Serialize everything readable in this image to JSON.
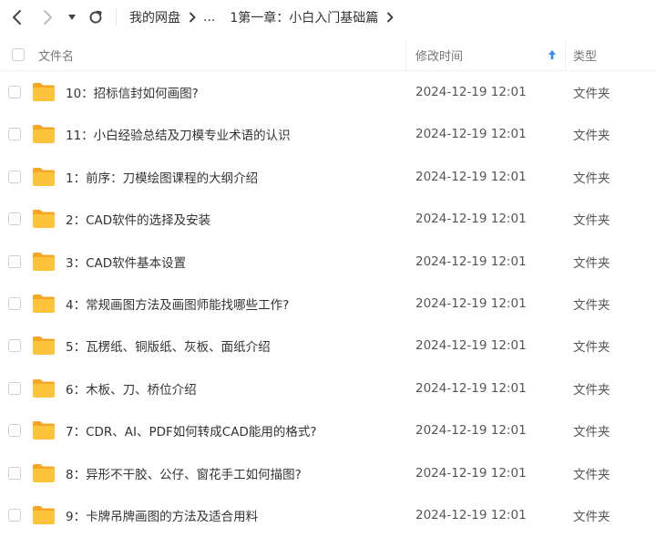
{
  "breadcrumb": {
    "root": "我的网盘",
    "ellipsis": "...",
    "current": "1第一章：小白入门基础篇"
  },
  "columns": {
    "name": "文件名",
    "modified": "修改时间",
    "type": "类型"
  },
  "colors": {
    "folder_body": "#FBC43B",
    "folder_tab": "#F5A623",
    "sort_arrow": "#2F8BF5"
  },
  "files": [
    {
      "name": "10：招标信封如何画图?",
      "modified": "2024-12-19 12:01",
      "type": "文件夹"
    },
    {
      "name": "11：小白经验总结及刀模专业术语的认识",
      "modified": "2024-12-19 12:01",
      "type": "文件夹"
    },
    {
      "name": "1：前序：刀模绘图课程的大纲介绍",
      "modified": "2024-12-19 12:01",
      "type": "文件夹"
    },
    {
      "name": "2：CAD软件的选择及安装",
      "modified": "2024-12-19 12:01",
      "type": "文件夹"
    },
    {
      "name": "3：CAD软件基本设置",
      "modified": "2024-12-19 12:01",
      "type": "文件夹"
    },
    {
      "name": "4：常规画图方法及画图师能找哪些工作?",
      "modified": "2024-12-19 12:01",
      "type": "文件夹"
    },
    {
      "name": "5：瓦楞纸、铜版纸、灰板、面纸介绍",
      "modified": "2024-12-19 12:01",
      "type": "文件夹"
    },
    {
      "name": "6：木板、刀、桥位介绍",
      "modified": "2024-12-19 12:01",
      "type": "文件夹"
    },
    {
      "name": "7：CDR、AI、PDF如何转成CAD能用的格式?",
      "modified": "2024-12-19 12:01",
      "type": "文件夹"
    },
    {
      "name": "8：异形不干胶、公仔、窗花手工如何描图?",
      "modified": "2024-12-19 12:01",
      "type": "文件夹"
    },
    {
      "name": "9：卡牌吊牌画图的方法及适合用料",
      "modified": "2024-12-19 12:01",
      "type": "文件夹"
    }
  ]
}
